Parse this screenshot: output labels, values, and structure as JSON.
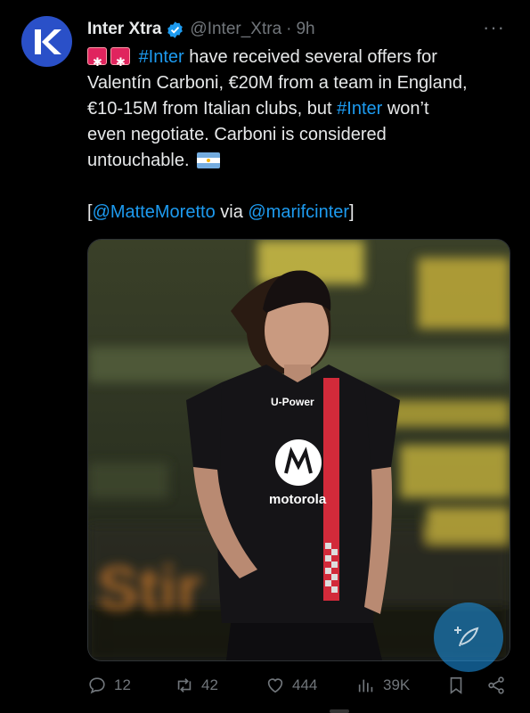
{
  "tweet": {
    "author_name": "Inter Xtra",
    "author_handle": "@Inter_Xtra",
    "separator": "·",
    "time": "9h",
    "avatar_letter": "K",
    "more_label": "···",
    "text": {
      "line1_hashtag": "#Inter",
      "line1_rest": " have received several offers for",
      "line2": "Valentín Carboni, €20M from a team in England,",
      "line3_a": "€10-15M from Italian clubs, but ",
      "line3_hashtag": "#Inter",
      "line3_b": " won’t",
      "line4": "even negotiate. Carboni is considered",
      "line5": "untouchable.",
      "credit_open": "[",
      "credit_mention1": "@MatteMoretto",
      "credit_via": " via ",
      "credit_mention2": "@marifcinter",
      "credit_close": "]"
    },
    "media": {
      "jersey_sponsor_top": "U-Power",
      "jersey_sponsor_main": "motorola",
      "background_sign": "Stir"
    },
    "actions": {
      "replies": "12",
      "reposts": "42",
      "likes": "444",
      "views": "39K"
    }
  },
  "colors": {
    "link": "#1d9bf0",
    "muted": "#71767b",
    "text": "#e7e9ea",
    "verified": "#1d9bf0",
    "avatar_bg": "#2a50c8"
  },
  "icons": [
    "verified-badge-icon",
    "more-icon",
    "siren-emoji",
    "argentina-flag-emoji",
    "reply-icon",
    "repost-icon",
    "like-icon",
    "views-icon",
    "bookmark-icon",
    "share-icon",
    "compose-icon"
  ]
}
